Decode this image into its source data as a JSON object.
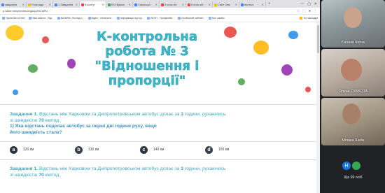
{
  "browser": {
    "tabs": [
      {
        "label": "завдання",
        "color": "#4285f4",
        "active": false
      },
      {
        "label": "Розкладу",
        "color": "#fbbc04",
        "active": false
      },
      {
        "label": "1 Завдання",
        "color": "#4285f4",
        "active": false
      },
      {
        "label": "К-контр",
        "color": "#ea4335",
        "active": true
      },
      {
        "label": "ЮЗ Вдисн",
        "color": "#34a853",
        "active": false
      },
      {
        "label": "Самооціл",
        "color": "#4285f4",
        "active": false
      },
      {
        "label": "5 клас віт",
        "color": "#ea4335",
        "active": false
      },
      {
        "label": "5 клас віт",
        "color": "#ea4335",
        "active": false
      },
      {
        "label": "Сайт Зем",
        "color": "#fbbc04",
        "active": false
      },
      {
        "label": "вчителі",
        "color": "#4285f4",
        "active": false
      }
    ],
    "url": "p.wizer.me/preview-legacy/Z5CWRJ",
    "bookmarks": [
      {
        "label": "Прочитати в Мої"
      },
      {
        "label": "Нові записи - Від..."
      },
      {
        "label": "БАЛКПК: Погляд н..."
      },
      {
        "label": "Відео - «Класичн..."
      },
      {
        "label": "Інформація про ку..."
      },
      {
        "label": "ЛКОП - Професійн..."
      },
      {
        "label": "Особистий кабінет..."
      },
      {
        "label": "Мої шкаби"
      },
      {
        "label": "Усі закладки",
        "right": true
      }
    ]
  },
  "page": {
    "title_lines": [
      "К-контрольна",
      "робота № 3",
      "\"Відношення і",
      "пропорції\""
    ],
    "question1": {
      "intro_a": "Завдання 1. ",
      "intro_b": "Відстань між Харковом та Дніпропетровськом автобус долає за ",
      "hours": "3",
      "intro_c": " години, рухаючись",
      "intro_d": "зі швидкістю ",
      "speed": "70",
      "intro_e": " км/год.",
      "sub_1": "1) Яка відстань подолає автобус за перші дві години руху, якщо",
      "sub_2": "його швидкість стала?"
    },
    "options": [
      {
        "letter": "a",
        "value": "120 км"
      },
      {
        "letter": "b",
        "value": "130 км"
      },
      {
        "letter": "c",
        "value": "140 км"
      },
      {
        "letter": "d",
        "value": "150 км"
      }
    ],
    "question2": {
      "intro_a": "Завдання 1. ",
      "intro_b": "Відстань між Харковом та Дніпропетровськом автобус долає за ",
      "hours": "3",
      "intro_c": " години, рухаючись",
      "intro_d": "зі швидкістю ",
      "speed": "70",
      "intro_e": " км/год."
    }
  },
  "participants": {
    "tiles": [
      {
        "name": "Євгенія Чепак"
      },
      {
        "name": "Олена СУББОТА"
      },
      {
        "name": "Мілана Шейн"
      }
    ],
    "more_initial": "Н",
    "more_label": "Ще 99 осіб"
  },
  "colors": {
    "title": "#3cb7c9",
    "question": "#3aa5c4",
    "accent_red": "#e53935"
  }
}
